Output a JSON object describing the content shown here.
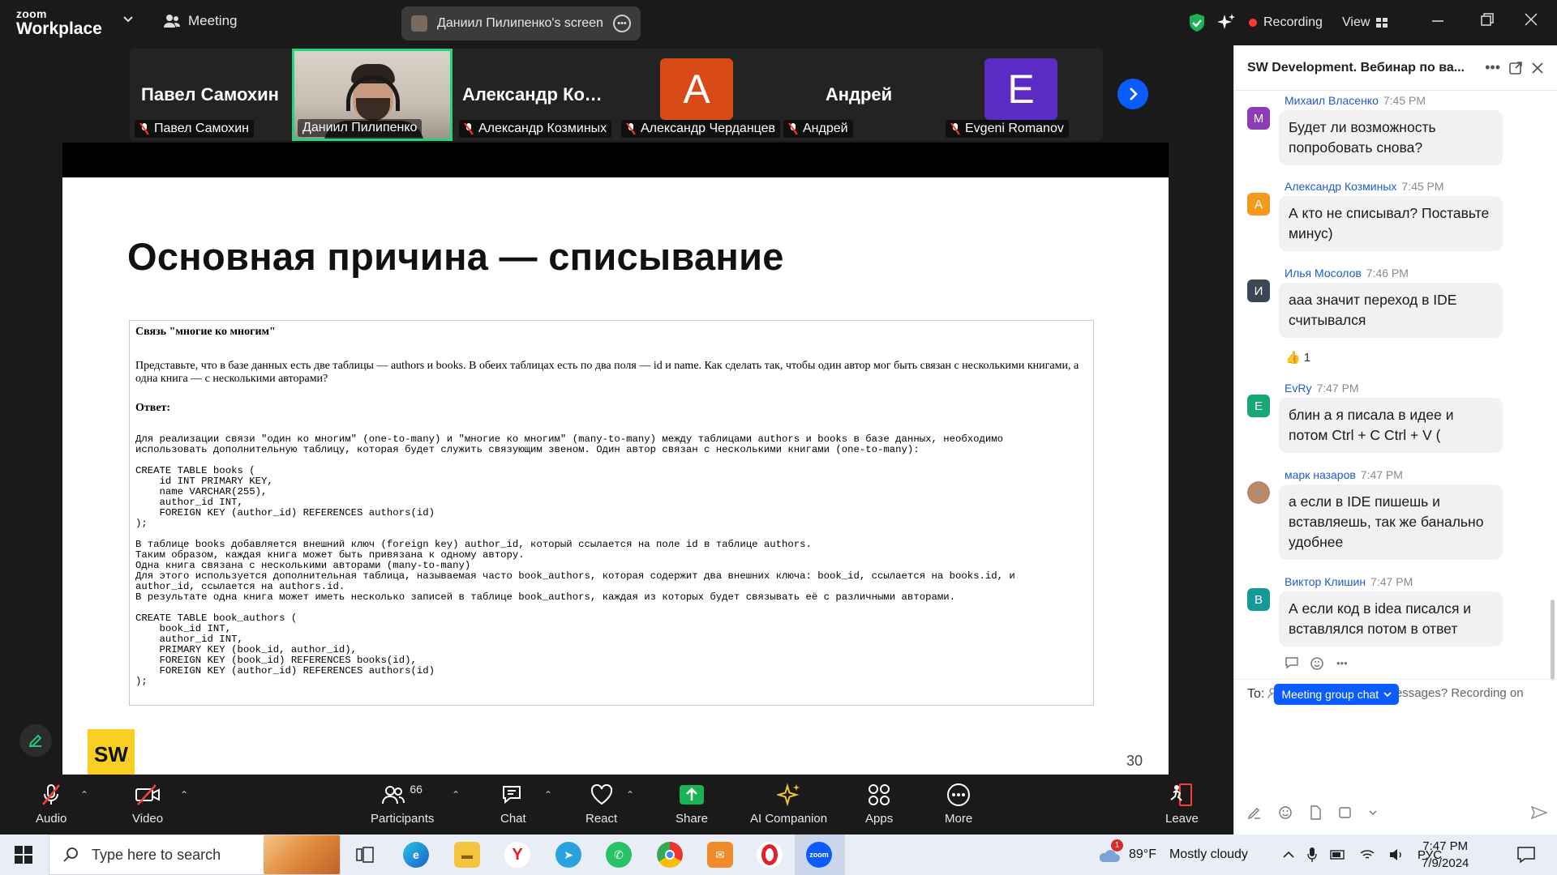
{
  "topbar": {
    "logo_line1": "zoom",
    "logo_line2": "Workplace",
    "meeting_label": "Meeting",
    "screen_share_label": "Даниил Пилипенко's screen",
    "recording_label": "Recording",
    "view_label": "View",
    "colors": {
      "accent": "#0b5cff",
      "recording_dot": "#ff3b30",
      "shield": "#19b354"
    }
  },
  "gallery": {
    "tiles": [
      {
        "big": "Павел Самохин",
        "name": "Павел Самохин",
        "muted": true
      },
      {
        "big": "",
        "name": "Даниил Пилипенко",
        "muted": false,
        "active": true,
        "video": true
      },
      {
        "big": "Александр Коз...",
        "name": "Александр Козминых",
        "muted": true
      },
      {
        "letter": "A",
        "letter_color": "#d84b16",
        "name": "Александр Черданцев",
        "muted": true
      },
      {
        "big": "Андрей",
        "name": "Андрей",
        "muted": true
      },
      {
        "letter": "E",
        "letter_color": "#5b2bc5",
        "name": "Evgeni Romanov",
        "muted": true
      }
    ]
  },
  "slide": {
    "title": "Основная причина — списывание",
    "doc": {
      "heading": "Связь \"многие ко многим\"",
      "question": "Представьте, что в базе данных есть две таблицы — authors и books. В обеих таблицах есть по два поля — id и name. Как сделать так, чтобы один автор мог быть связан с несколькими книгами, а одна книга — с несколькими авторами?",
      "answer_label": "Ответ:",
      "answer_intro": "Для реализации связи \"один ко многим\" (one-to-many) и \"многие ко многим\" (many-to-many) между таблицами authors и books в базе данных, необходимо\nиспользовать дополнительную таблицу, которая будет служить связующим звеном. Один автор связан с несколькими книгами (one-to-many):",
      "code1": "CREATE TABLE books (\n    id INT PRIMARY KEY,\n    name VARCHAR(255),\n    author_id INT,\n    FOREIGN KEY (author_id) REFERENCES authors(id)\n);",
      "explain": "В таблице books добавляется внешний ключ (foreign key) author_id, который ссылается на поле id в таблице authors.\nТаким образом, каждая книга может быть привязана к одному автору.\nОдна книга связана с несколькими авторами (many-to-many)\nДля этого используется дополнительная таблица, называемая часто book_authors, которая содержит два внешних ключа: book_id, ссылается на books.id, и\nauthor_id, ссылается на authors.id.\nВ результате одна книга может иметь несколько записей в таблице book_authors, каждая из которых будет связывать её с различными авторами.",
      "code2": "CREATE TABLE book_authors (\n    book_id INT,\n    author_id INT,\n    PRIMARY KEY (book_id, author_id),\n    FOREIGN KEY (book_id) REFERENCES books(id),\n    FOREIGN KEY (author_id) REFERENCES authors(id)\n);"
    },
    "logo_text": "SW",
    "page_number": "30"
  },
  "chat": {
    "title": "SW Development. Вебинар по ва...",
    "messages": [
      {
        "initial": "М",
        "color": "#8e3bb8",
        "name": "Михаил Власенко",
        "time": "7:45 PM",
        "text": "Будет ли возможность попробовать снова?"
      },
      {
        "initial": "А",
        "color": "#f29a1a",
        "name": "Александр Козминых",
        "time": "7:45 PM",
        "text": "А кто не списывал? Поставьте минус)"
      },
      {
        "initial": "И",
        "color": "#3b4656",
        "name": "Илья Мосолов",
        "time": "7:46 PM",
        "text": "ааа значит переход в IDE считывался"
      },
      {
        "initial": "E",
        "color": "#1aa776",
        "name": "EvRy",
        "time": "7:47 PM",
        "text": "блин а я писала в идее и потом Ctrl + C Ctrl + V ("
      },
      {
        "initial": "",
        "color": "#b88a6a",
        "name": "марк назаров",
        "time": "7:47 PM",
        "text": "а если в IDE пишешь и вставляешь, так же банально удобнее"
      },
      {
        "initial": "В",
        "color": "#159a9a",
        "name": "Виктор Клишин",
        "time": "7:47 PM",
        "text": "А если код в idea писался и вставлялся потом в ответ"
      }
    ],
    "reaction": {
      "emoji": "👍",
      "count": "1"
    },
    "privacy_note": "Who can see your messages? Recording on",
    "to_label": "To:",
    "to_value": "Meeting group chat"
  },
  "toolbar": {
    "audio": "Audio",
    "video": "Video",
    "participants": "Participants",
    "participants_count": "66",
    "chat": "Chat",
    "react": "React",
    "share": "Share",
    "ai_companion": "AI Companion",
    "apps": "Apps",
    "more": "More",
    "leave": "Leave"
  },
  "taskbar": {
    "search_placeholder": "Type here to search",
    "weather_temp": "89°F",
    "weather_text": "Mostly cloudy",
    "weather_badge": "1",
    "language": "РУС",
    "time": "7:47 PM",
    "date": "7/9/2024"
  }
}
